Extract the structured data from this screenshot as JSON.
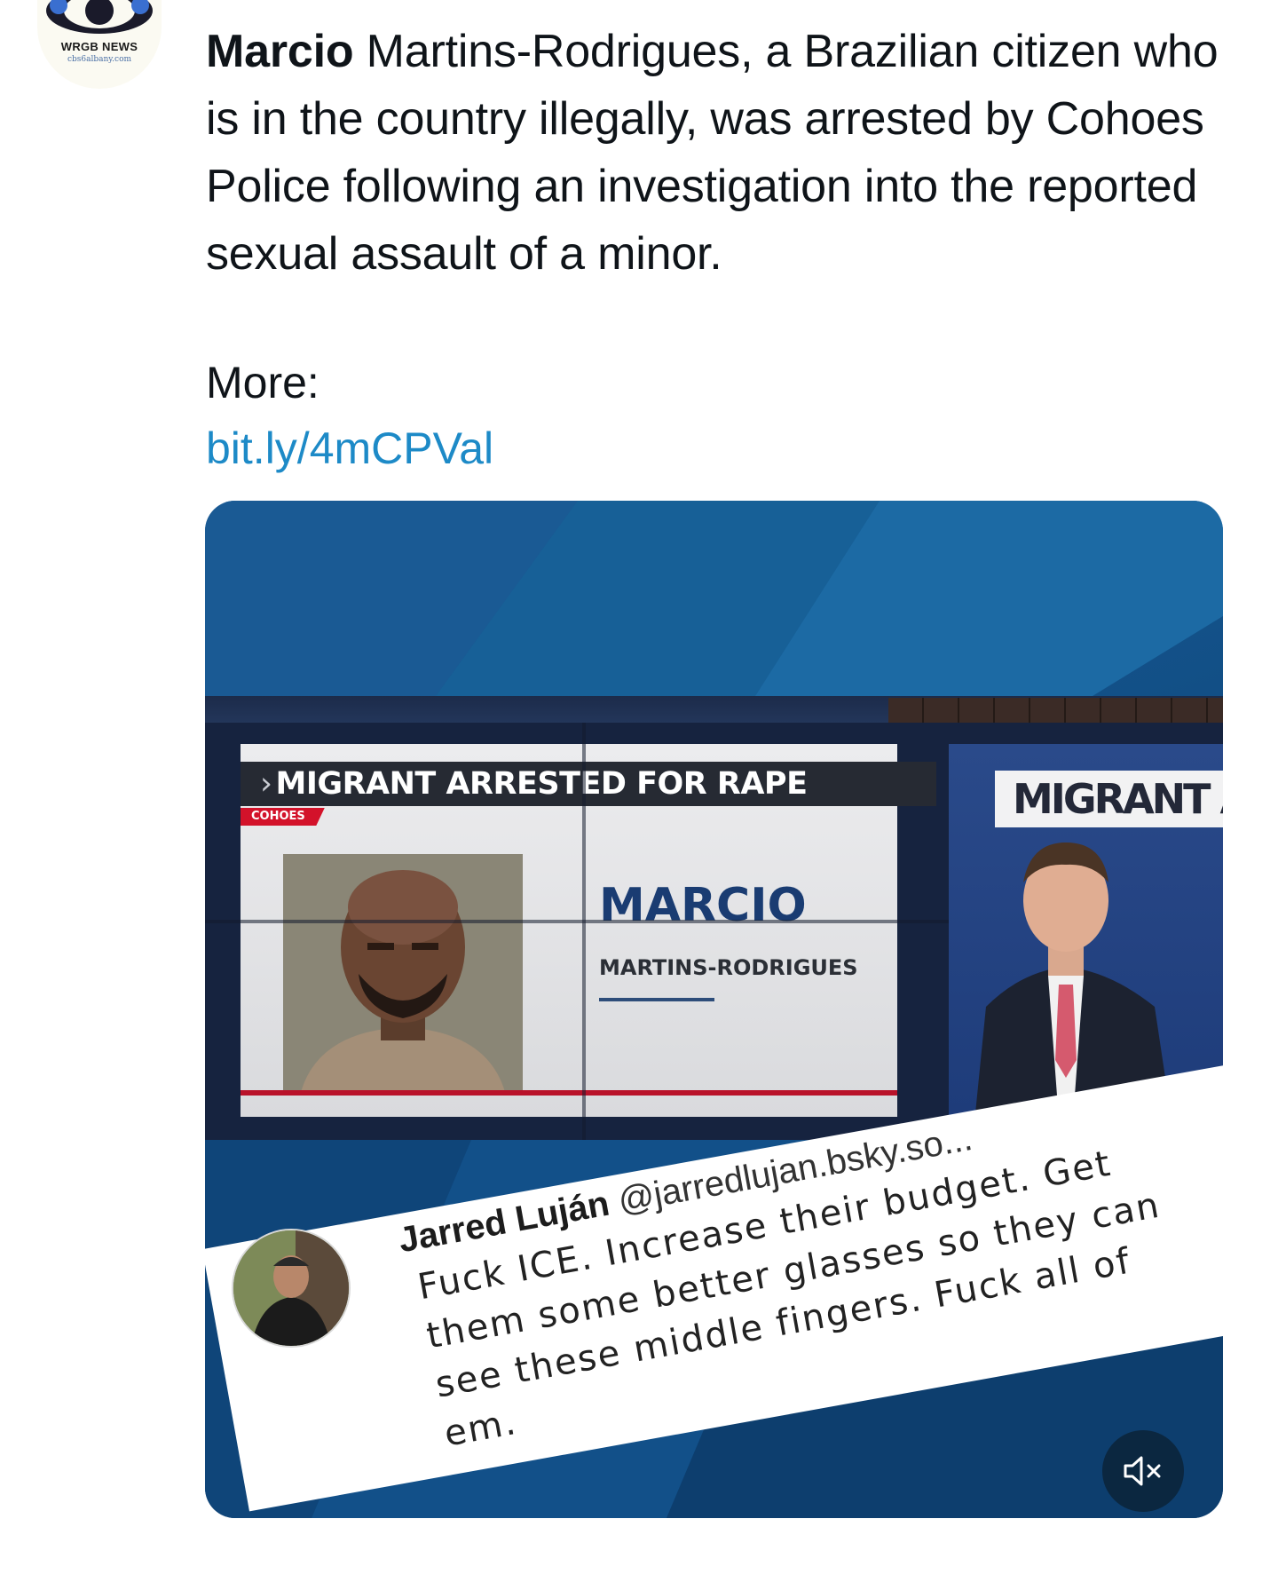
{
  "avatar": {
    "brand": "WRGB NEWS",
    "site": "cbs6albany.com",
    "icon": "cbs-eye-logo-icon"
  },
  "tweet": {
    "highlight": "Marcio",
    "text_rest": " Martins-Rodrigues, a Brazilian citizen who is in the country illegally, was arrested by Cohoes Police following an investigation into the reported sexual assault of a minor.",
    "more_label": "More:",
    "link": "bit.ly/4mCPVal"
  },
  "media": {
    "headline": "MIGRANT ARRESTED FOR RAPE",
    "location_tag": "COHOES",
    "name_first": "MARCIO",
    "name_last": "MARTINS-RODRIGUES",
    "headline_right": "MIGRANT AF",
    "quote": {
      "author_name": "Jarred Luján",
      "author_handle": "@jarredlujan.bsky.so...",
      "body": "Fuck ICE. Increase their budget. Get them some better glasses so they can see these middle fingers. Fuck all of em."
    },
    "mute_icon": "speaker-muted-icon"
  },
  "colors": {
    "link": "#1d8ac7",
    "media_bg": "#124f86",
    "headline_red": "#d3122a",
    "mute_btn": "#0b2740"
  }
}
